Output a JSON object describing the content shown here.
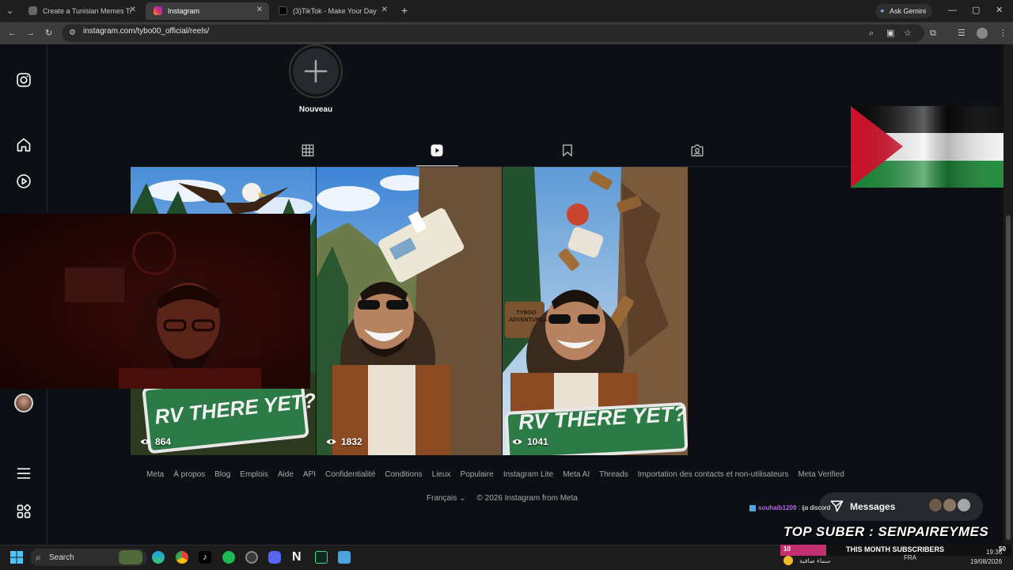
{
  "browser": {
    "tabs": [
      {
        "title": "Create a Tunisian Memes Tier L",
        "active": false
      },
      {
        "title": "Instagram",
        "active": true
      },
      {
        "title": "(3)TikTok - Make Your Day",
        "active": false
      }
    ],
    "url": "instagram.com/tybo00_official/reels/",
    "ask_gemini": "Ask Gemini"
  },
  "profile": {
    "new_highlight_label": "Nouveau"
  },
  "reels": [
    {
      "views": "864"
    },
    {
      "views": "1832"
    },
    {
      "views": "1041"
    }
  ],
  "reel_signs": {
    "sign_text": "RV THERE YET?",
    "tybo_sign": "TYBOO ADVENTURES"
  },
  "footer": {
    "links": [
      "Meta",
      "À propos",
      "Blog",
      "Emplois",
      "Aide",
      "API",
      "Confidentialité",
      "Conditions",
      "Lieux",
      "Populaire",
      "Instagram Lite",
      "Meta AI",
      "Threads",
      "Importation des contacts et non-utilisateurs",
      "Meta Verified"
    ],
    "language": "Français",
    "copyright": "© 2026 Instagram from Meta"
  },
  "messages": {
    "label": "Messages"
  },
  "overlay": {
    "chat_user": "souhaib1209",
    "chat_message": ": ija discord",
    "top_suber": "TOP SUBER : SENPAIREYMES",
    "subs_count": "10",
    "subs_label": "THIS MONTH SUBSCRIBERS",
    "subs_goal": "50",
    "subs_fraction": 0.2
  },
  "taskbar": {
    "search_label": "Search",
    "weather_text": "سماء صافية",
    "lang": "FRA",
    "time": "19:36",
    "date": "19/08/2026"
  },
  "colors": {
    "bg": "#0c1014",
    "flag_red": "#d1112b",
    "flag_green": "#1d8a3a",
    "accent_pink": "#c4306f"
  }
}
